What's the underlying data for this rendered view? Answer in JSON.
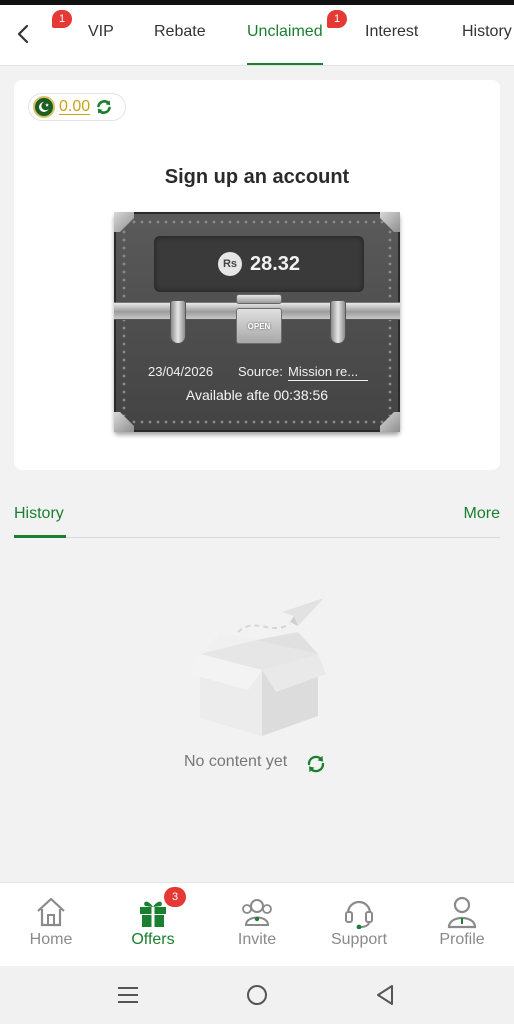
{
  "top_tabs": {
    "back_badge": "1",
    "tabs": [
      {
        "label": "VIP"
      },
      {
        "label": "Rebate"
      },
      {
        "label": "Unclaimed",
        "badge": "1",
        "active": true
      },
      {
        "label": "Interest"
      },
      {
        "label": "History"
      }
    ]
  },
  "balance": {
    "value": "0.00",
    "flag_icon": "pakistan-flag-icon"
  },
  "offer_card": {
    "title": "Sign up an account",
    "currency_symbol": "Rs",
    "amount": "28.32",
    "lock_label": "OPEN",
    "date": "23/04/2026",
    "source_label": "Source:",
    "source_value": "Mission re...",
    "available_text": "Available afte 00:38:56"
  },
  "history": {
    "title": "History",
    "more_label": "More",
    "empty_text": "No content yet"
  },
  "bottom_nav": {
    "items": [
      {
        "label": "Home",
        "icon": "home-icon"
      },
      {
        "label": "Offers",
        "icon": "gift-icon",
        "badge": "3",
        "active": true
      },
      {
        "label": "Invite",
        "icon": "invite-icon"
      },
      {
        "label": "Support",
        "icon": "headset-icon"
      },
      {
        "label": "Profile",
        "icon": "profile-icon"
      }
    ]
  },
  "colors": {
    "accent": "#1a7f2e",
    "badge": "#e53935",
    "balance": "#c9a416"
  }
}
